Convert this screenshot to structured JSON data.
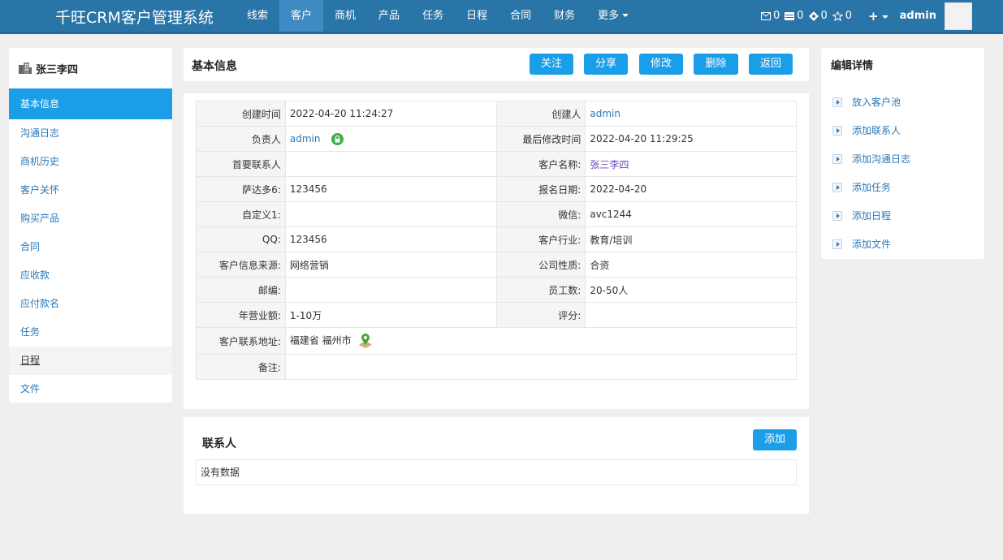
{
  "header": {
    "brand": "千旺CRM客户管理系统",
    "nav": [
      "线索",
      "客户",
      "商机",
      "产品",
      "任务",
      "日程",
      "合同",
      "财务",
      "更多"
    ],
    "active_nav": "客户",
    "stats": {
      "mail": "0",
      "list": "0",
      "diamond": "0",
      "star": "0"
    },
    "plus": "+",
    "user": "admin"
  },
  "left": {
    "title": "张三李四",
    "items": [
      "基本信息",
      "沟通日志",
      "商机历史",
      "客户关怀",
      "购买产品",
      "合同",
      "应收款",
      "应付款名",
      "任务",
      "日程",
      "文件"
    ]
  },
  "main": {
    "title": "基本信息",
    "buttons": [
      "关注",
      "分享",
      "修改",
      "删除",
      "返回"
    ]
  },
  "info": {
    "r1": {
      "l1": "创建时间",
      "v1": "2022-04-20 11:24:27",
      "l2": "创建人",
      "v2": "admin"
    },
    "r2": {
      "l1": "负责人",
      "v1": "admin",
      "l2": "最后修改时间",
      "v2": "2022-04-20 11:29:25"
    },
    "r3": {
      "l1": "首要联系人",
      "v1": "",
      "l2": "客户名称:",
      "v2": "张三李四"
    },
    "r4": {
      "l1": "萨达多6:",
      "v1": "123456",
      "l2": "报名日期:",
      "v2": "2022-04-20"
    },
    "r5": {
      "l1": "自定义1:",
      "v1": "",
      "l2": "微信:",
      "v2": "avc1244"
    },
    "r6": {
      "l1": "QQ:",
      "v1": "123456",
      "l2": "客户行业:",
      "v2": "教育/培训"
    },
    "r7": {
      "l1": "客户信息来源:",
      "v1": "网络营销",
      "l2": "公司性质:",
      "v2": "合资"
    },
    "r8": {
      "l1": "邮编:",
      "v1": "",
      "l2": "员工数:",
      "v2": "20-50人"
    },
    "r9": {
      "l1": "年营业额:",
      "v1": "1-10万",
      "l2": "评分:",
      "v2": ""
    },
    "r10": {
      "l1": "客户联系地址:",
      "v1": "福建省 福州市"
    },
    "r11": {
      "l1": "备注:",
      "v1": ""
    }
  },
  "contacts": {
    "title": "联系人",
    "add": "添加",
    "empty": "没有数据"
  },
  "right": {
    "title": "编辑详情",
    "items": [
      "放入客户池",
      "添加联系人",
      "添加沟通日志",
      "添加任务",
      "添加日程",
      "添加文件"
    ]
  }
}
